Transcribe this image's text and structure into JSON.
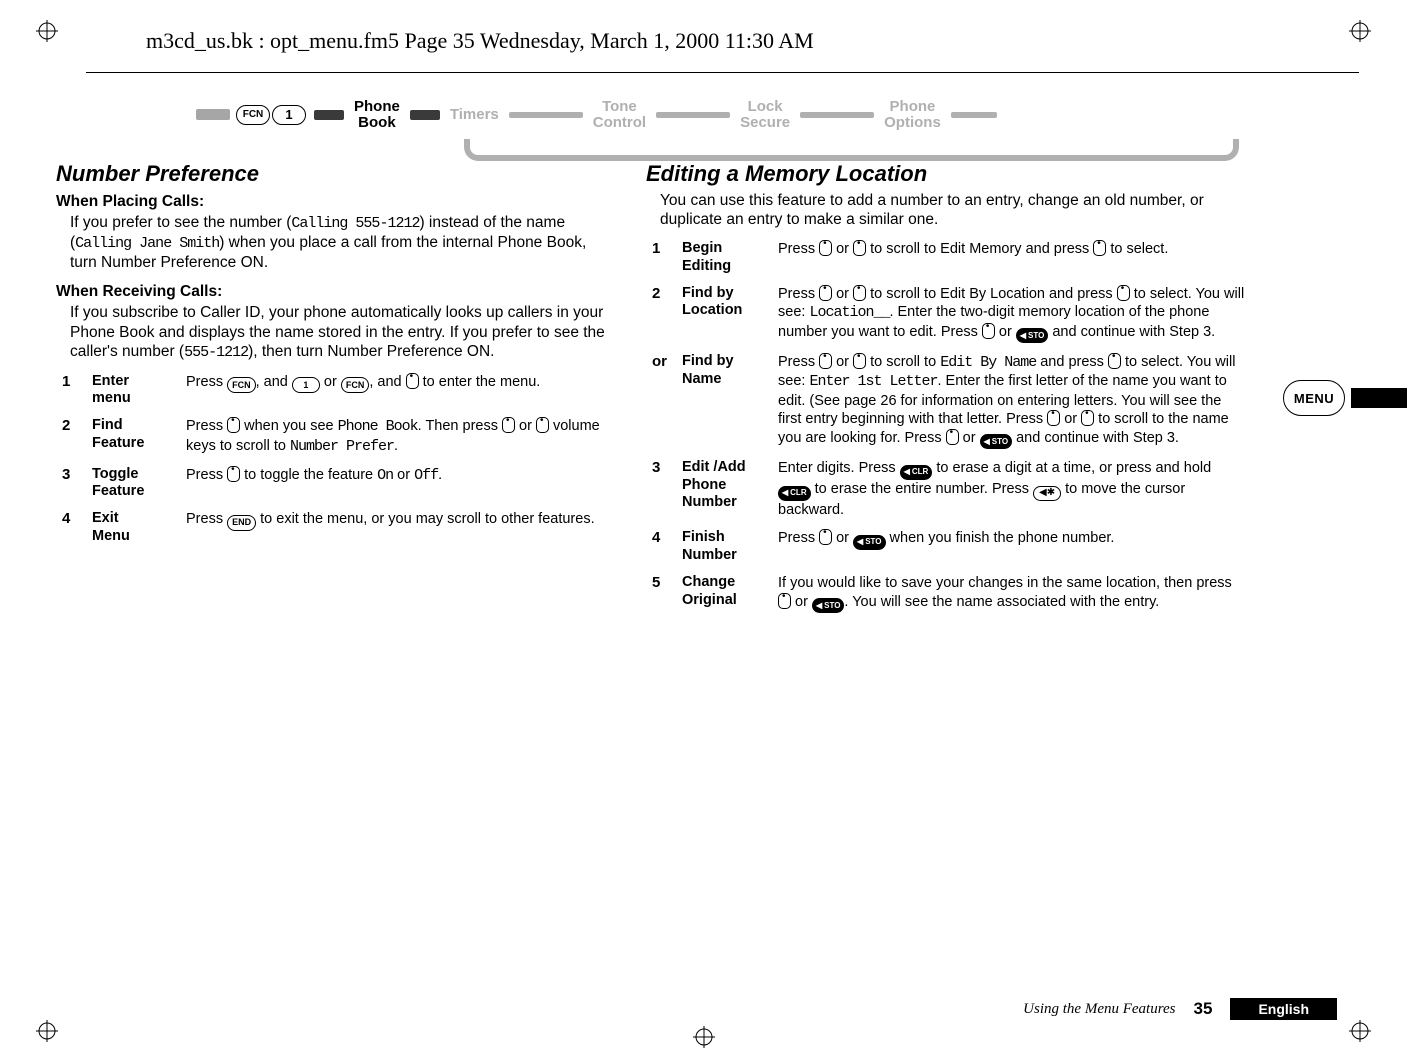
{
  "doc_header": "m3cd_us.bk : opt_menu.fm5  Page 35  Wednesday, March 1, 2000  11:30 AM",
  "nav": {
    "key1": "FCN",
    "key2": "1",
    "items": [
      "Phone\nBook",
      "Timers",
      "Tone\nControl",
      "Lock\nSecure",
      "Phone\nOptions"
    ]
  },
  "menu_tab": "MENU",
  "left": {
    "title": "Number Preference",
    "sub1": "When Placing Calls:",
    "p1a": "If you prefer to see the number (",
    "p1b": ") instead of the name (",
    "p1c": ") when you place a call from the internal Phone Book, turn Number Preference ON.",
    "lcd1": "Calling 555-1212",
    "lcd2": "Calling Jane Smith",
    "sub2": "When Receiving Calls:",
    "p2a": "If you subscribe to Caller ID, your phone automatically looks up callers in your Phone Book and displays the name stored in the entry. If you prefer to see the caller's number (",
    "p2b": "), then turn Number Preference ON.",
    "lcd3": "555-1212",
    "steps": [
      {
        "n": "1",
        "label": "Enter\nmenu",
        "d": [
          "Press ",
          {
            "k": "oval",
            "t": "FCN"
          },
          ", and ",
          {
            "k": "oval",
            "t": "1"
          },
          " or ",
          {
            "k": "oval",
            "t": "FCN"
          },
          ", and ",
          {
            "k": "ud"
          },
          " to enter the menu."
        ]
      },
      {
        "n": "2",
        "label": "Find\nFeature",
        "d": [
          "Press ",
          {
            "k": "ud"
          },
          " when you see ",
          {
            "lcd": "Phone Book"
          },
          ". Then press ",
          {
            "k": "ud"
          },
          " or ",
          {
            "k": "ud"
          },
          " volume keys to scroll to ",
          {
            "lcd": "Number Prefer"
          },
          "."
        ]
      },
      {
        "n": "3",
        "label": "Toggle\nFeature",
        "d": [
          "Press ",
          {
            "k": "ud"
          },
          " to toggle the feature ",
          {
            "lcd": "On"
          },
          " or ",
          {
            "lcd": "Off"
          },
          "."
        ]
      },
      {
        "n": "4",
        "label": "Exit\nMenu",
        "d": [
          "Press ",
          {
            "k": "oval",
            "t": "END"
          },
          " to exit the menu, or you may scroll to other features."
        ]
      }
    ]
  },
  "right": {
    "title": "Editing a Memory Location",
    "intro": "You can use this feature to add a number to an entry, change an old number, or duplicate an entry to make a similar one.",
    "steps": [
      {
        "n": "1",
        "label": "Begin\nEditing",
        "d": [
          "Press ",
          {
            "k": "ud"
          },
          " or ",
          {
            "k": "ud"
          },
          " to scroll to Edit Memory and press ",
          {
            "k": "ud"
          },
          " to select."
        ]
      },
      {
        "n": "2",
        "label": "Find by\nLocation",
        "d": [
          "Press ",
          {
            "k": "ud"
          },
          " or ",
          {
            "k": "ud"
          },
          " to scroll to Edit By Location and press ",
          {
            "k": "ud"
          },
          " to select. You will see: ",
          {
            "lcd": "Location__"
          },
          ". Enter the two-digit memory location of the phone number you want to edit. Press ",
          {
            "k": "ud"
          },
          " or ",
          {
            "k": "cap",
            "t": "STO"
          },
          " and continue with Step 3."
        ]
      },
      {
        "n": "or",
        "label": "Find by\nName",
        "d": [
          "Press ",
          {
            "k": "ud"
          },
          " or ",
          {
            "k": "ud"
          },
          " to scroll to ",
          {
            "lcd": "Edit By Name"
          },
          " and press ",
          {
            "k": "ud"
          },
          " to select. You will see: ",
          {
            "lcd": "Enter 1st Letter"
          },
          ". Enter the first letter of the name you want to edit. (See page 26 for information on entering letters. You will see the first entry beginning with that letter. Press ",
          {
            "k": "ud"
          },
          " or ",
          {
            "k": "ud"
          },
          " to scroll to the name you are looking for. Press ",
          {
            "k": "ud"
          },
          " or ",
          {
            "k": "cap",
            "t": "STO"
          },
          " and continue with Step 3."
        ]
      },
      {
        "n": "3",
        "label": "Edit /Add\nPhone\nNumber",
        "d": [
          "Enter digits. Press ",
          {
            "k": "cap",
            "t": "CLR"
          },
          " to erase a digit at a time, or press and hold ",
          {
            "k": "cap",
            "t": "CLR"
          },
          " to erase the entire number. Press ",
          {
            "k": "star",
            "t": "◀✱"
          },
          " to move the cursor backward."
        ]
      },
      {
        "n": "4",
        "label": "Finish\nNumber",
        "d": [
          "Press ",
          {
            "k": "ud"
          },
          " or ",
          {
            "k": "cap",
            "t": "STO"
          },
          " when you finish the phone number."
        ]
      },
      {
        "n": "5",
        "label": "Change\nOriginal",
        "d": [
          "If you would like to save your changes in the same location, then press ",
          {
            "k": "ud"
          },
          " or ",
          {
            "k": "cap",
            "t": "STO"
          },
          ". You will see the name associated with the entry."
        ]
      }
    ]
  },
  "footer": {
    "section": "Using the Menu Features",
    "page": "35",
    "lang": "English"
  }
}
